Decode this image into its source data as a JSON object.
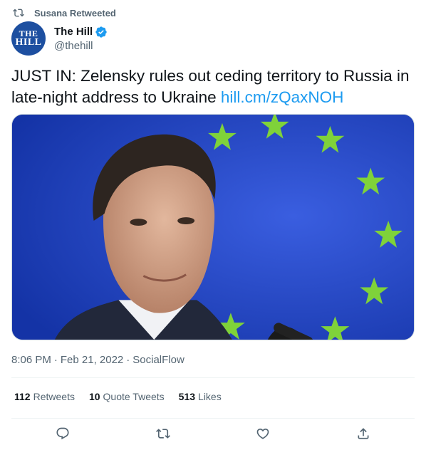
{
  "retweet_context": {
    "label": "Susana Retweeted",
    "icon": "retweet-icon"
  },
  "author": {
    "avatar_line1": "THE",
    "avatar_line2": "HILL",
    "display_name": "The Hill",
    "handle": "@thehill",
    "verified_icon": "verified-badge-icon"
  },
  "tweet": {
    "text": "JUST IN: Zelensky rules out ceding territory to Russia in late-night address to Ukraine ",
    "link": "hill.cm/zQaxNOH"
  },
  "media": {
    "description_icon": "photo"
  },
  "meta": {
    "time": "8:06 PM",
    "separator": "·",
    "date": "Feb 21, 2022",
    "source": "SocialFlow"
  },
  "stats": {
    "retweets_count": "112",
    "retweets_label": "Retweets",
    "quotes_count": "10",
    "quotes_label": "Quote Tweets",
    "likes_count": "513",
    "likes_label": "Likes"
  },
  "actions": [
    "reply-icon",
    "retweet-icon",
    "like-icon",
    "share-icon"
  ],
  "colors": {
    "link": "#1d9bf0",
    "muted": "#536471",
    "text": "#0f1419",
    "avatar_bg": "#1d4fa0",
    "eu_blue": "#1f3fb8",
    "eu_star": "#7fd23a"
  }
}
